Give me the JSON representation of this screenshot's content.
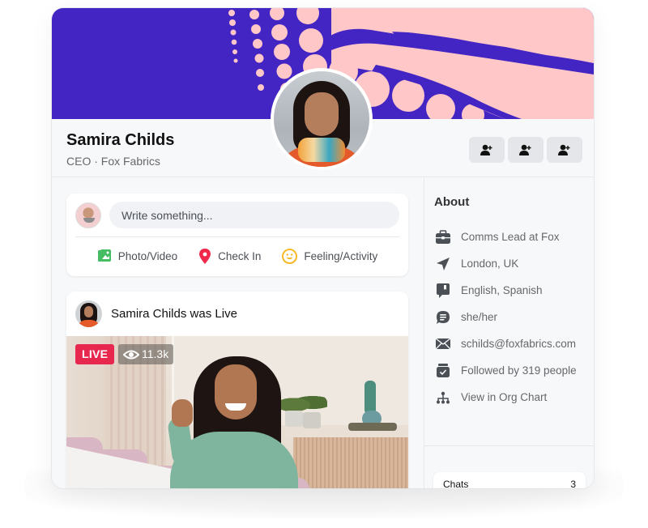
{
  "profile": {
    "name": "Samira Childs",
    "subtitle": "CEO · Fox Fabrics"
  },
  "cover": {
    "primary_color": "#4325c4",
    "accent_color": "#ffc7c7"
  },
  "follow_buttons": [
    {
      "icon": "add-person-icon"
    },
    {
      "icon": "add-person-icon"
    },
    {
      "icon": "add-person-icon"
    }
  ],
  "composer": {
    "placeholder": "Write something...",
    "actions": [
      {
        "label": "Photo/Video",
        "icon": "photo-icon",
        "color": "#45bd62"
      },
      {
        "label": "Check In",
        "icon": "location-pin-icon",
        "color": "#f02849"
      },
      {
        "label": "Feeling/Activity",
        "icon": "smiley-icon",
        "color": "#f7b928"
      }
    ]
  },
  "post": {
    "author": "Samira Childs",
    "action_text": "was Live",
    "live_label": "LIVE",
    "viewers": "11.3k",
    "live_color": "#e8274f"
  },
  "about": {
    "title": "About",
    "items": [
      {
        "icon": "briefcase-icon",
        "text": "Comms Lead at Fox"
      },
      {
        "icon": "location-arrow-icon",
        "text": "London, UK"
      },
      {
        "icon": "language-bubble-icon",
        "text": "English, Spanish"
      },
      {
        "icon": "pronouns-chat-icon",
        "text": "she/her"
      },
      {
        "icon": "envelope-icon",
        "text": "schilds@foxfabrics.com"
      },
      {
        "icon": "followers-check-icon",
        "text": "Followed by 319 people"
      },
      {
        "icon": "org-chart-icon",
        "text": "View in Org Chart"
      }
    ]
  },
  "chats": {
    "label": "Chats",
    "count": "3"
  }
}
